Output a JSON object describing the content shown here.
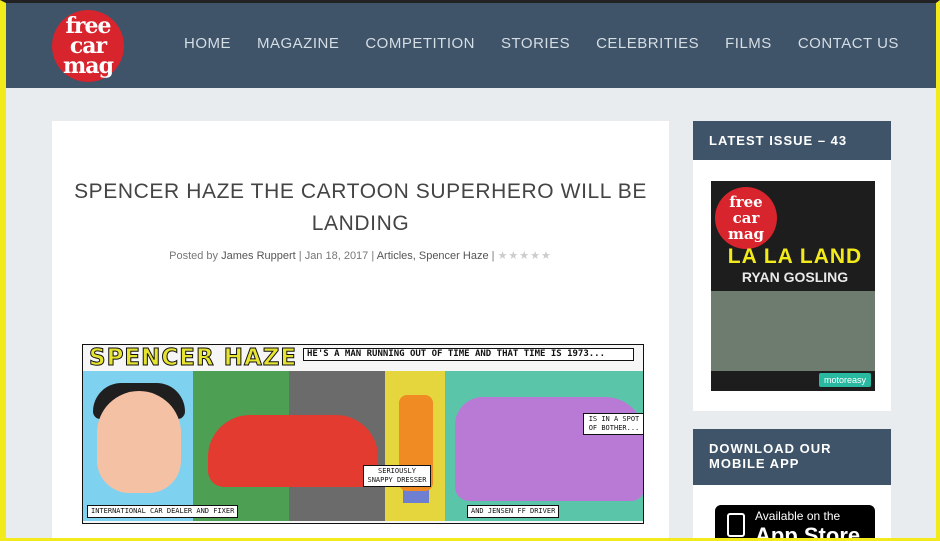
{
  "header": {
    "logo_lines": [
      "free",
      "car",
      "mag"
    ],
    "nav": [
      "HOME",
      "MAGAZINE",
      "COMPETITION",
      "STORIES",
      "CELEBRITIES",
      "FILMS",
      "CONTACT US"
    ]
  },
  "article": {
    "title": "SPENCER HAZE THE CARTOON SUPERHERO WILL BE LANDING",
    "meta": {
      "posted_by": "Posted by",
      "author": "James Ruppert",
      "date": "Jan 18, 2017",
      "categories": "Articles, Spencer Haze",
      "rating_stars": "★★★★★"
    },
    "comic": {
      "title": "SPENCER HAZE",
      "caption_top": "He's a man running out of time and that time is 1973...",
      "caption_dealer": "INTERNATIONAL CAR DEALER AND FIXER",
      "caption_dresser": "SERIOUSLY SNAPPY DRESSER",
      "caption_jensen": "AND JENSEN FF DRIVER",
      "caption_bother": "IS IN A SPOT OF BOTHER..."
    }
  },
  "sidebar": {
    "latest_issue": {
      "heading": "LATEST ISSUE – 43",
      "cover_logo": [
        "free",
        "car",
        "mag"
      ],
      "cover_headline": "LA LA LAND",
      "cover_subline": "RYAN GOSLING",
      "cover_badge": "motoreasy"
    },
    "app": {
      "heading": "DOWNLOAD OUR MOBILE APP",
      "badge_small": "Available on the",
      "badge_big": "App Store"
    }
  },
  "colors": {
    "header_bg": "#3f5468",
    "logo_red": "#d8242d",
    "frame_yellow": "#f3ea1b"
  }
}
